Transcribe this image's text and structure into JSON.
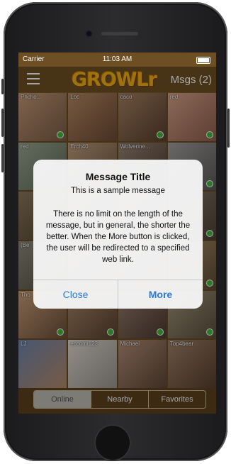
{
  "status_bar": {
    "carrier": "Carrier",
    "time": "11:03 AM"
  },
  "nav": {
    "logo": "GROWLr",
    "messages": "Msgs (2)"
  },
  "grid": {
    "tiles": [
      {
        "name": "Pncho..."
      },
      {
        "name": "Loc"
      },
      {
        "name": "caco"
      },
      {
        "name": "red"
      },
      {
        "name": "red"
      },
      {
        "name": "Erch40"
      },
      {
        "name": "Wolverine..."
      },
      {
        "name": ""
      },
      {
        "name": ""
      },
      {
        "name": ""
      },
      {
        "name": ""
      },
      {
        "name": ""
      },
      {
        "name": "(Be"
      },
      {
        "name": ""
      },
      {
        "name": ""
      },
      {
        "name": ""
      },
      {
        "name": "Tho"
      },
      {
        "name": ""
      },
      {
        "name": ""
      },
      {
        "name": ""
      },
      {
        "name": "LJ"
      },
      {
        "name": "eccomi123"
      },
      {
        "name": "Michael"
      },
      {
        "name": "Top4bear"
      }
    ]
  },
  "alert": {
    "title": "Message Title",
    "subtitle": "This is a sample message",
    "body": "There is no limit on the length of the message, but in general, the shorter the better.  When the More button is clicked, the user will be redirected to a specified web link.",
    "close_label": "Close",
    "more_label": "More"
  },
  "tabs": [
    "Online",
    "Nearby",
    "Favorites"
  ],
  "colors": {
    "brand": "#f2b118",
    "accent": "#2a7ad8",
    "online": "#3fba3f"
  }
}
